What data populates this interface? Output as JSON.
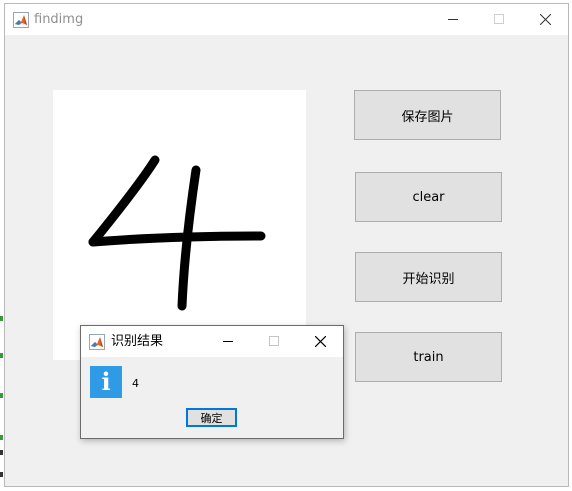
{
  "main_window": {
    "title": "findimg",
    "icon": "matlab-icon",
    "controls": [
      "minimize-icon",
      "maximize-icon",
      "close-icon"
    ]
  },
  "canvas": {
    "drawn_digit": "4",
    "stroke_color": "#000000",
    "background": "#ffffff"
  },
  "buttons": {
    "save": "保存图片",
    "clear": "clear",
    "recognize": "开始识别",
    "train": "train"
  },
  "dialog": {
    "title": "识别结果",
    "icon": "info-icon",
    "info_glyph": "i",
    "message": "4",
    "ok_label": "确定"
  },
  "colors": {
    "window_bg": "#f0f0f0",
    "titlebar_bg": "#ffffff",
    "button_bg": "#e1e1e1",
    "button_border": "#adadad",
    "info_icon": "#2f9ae6",
    "focus_border": "#0078d7"
  }
}
